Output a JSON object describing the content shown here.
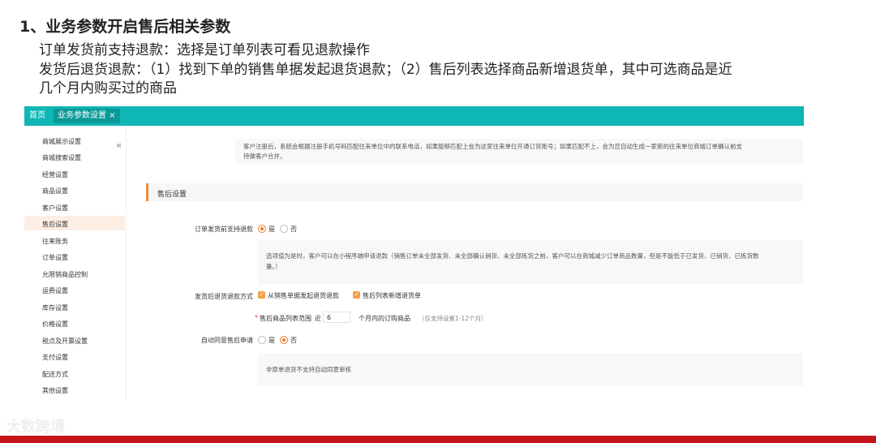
{
  "slide": {
    "heading": "1、业务参数开启售后相关参数",
    "desc_lines": [
      "订单发货前支持退款：选择是订单列表可看见退款操作",
      "发货后退货退款：（1）找到下单的销售单据发起退货退款；（2）售后列表选择商品新增退货单，其中可选商品是近",
      "几个月内购买过的商品"
    ],
    "watermark": "大数跨境"
  },
  "tabs": {
    "home": "首页",
    "active": "业务参数设置 ×"
  },
  "sidebar": {
    "collapse": "«",
    "items": [
      "商城展示设置",
      "商城搜索设置",
      "经营设置",
      "商品设置",
      "客户设置",
      "售后设置",
      "往来账务",
      "订单设置",
      "允限销商品控制",
      "运费设置",
      "库存设置",
      "价格设置",
      "税点及开票设置",
      "支付设置",
      "配送方式",
      "其他设置"
    ],
    "active_index": 5
  },
  "main": {
    "customer_note": [
      "客户注册后，系统会根据注册手机号码匹配往来单位中的联系电话，如果能够匹配上会为这家往来单位开通订货账号；如果匹配不上，会为您自动生成一家新的往来单位商城订单确认前支",
      "持做客户合并。"
    ],
    "section_title": "售后设置",
    "refund_before_ship": {
      "label": "订单发货前支持退款",
      "yes": "是",
      "no": "否",
      "selected": "是"
    },
    "refund_note": [
      "选项值为是时，客户可以在小程序端申请退款（销售订单未全部发货、未全部确认销货、未全部拣货之前，客户可以在商城减少订单商品数量，但是不能低于已发货、已销货、已拣货数",
      "量。）"
    ],
    "return_after_ship": {
      "label": "发货后退货退款方式",
      "option1": "从销售单据发起退货退款",
      "option2": "售后列表新增退货单"
    },
    "product_range": {
      "required_mark": "*",
      "label": "售后商品列表范围",
      "prefix": "近",
      "value": "6",
      "suffix": "个月内的订购商品",
      "hint": "（仅支持设置1-12个月）"
    },
    "auto_agree": {
      "label": "自动同意售后申请",
      "yes": "是",
      "no": "否",
      "selected": "否"
    },
    "auto_note": "非原单退货不支持自动同意审核"
  }
}
